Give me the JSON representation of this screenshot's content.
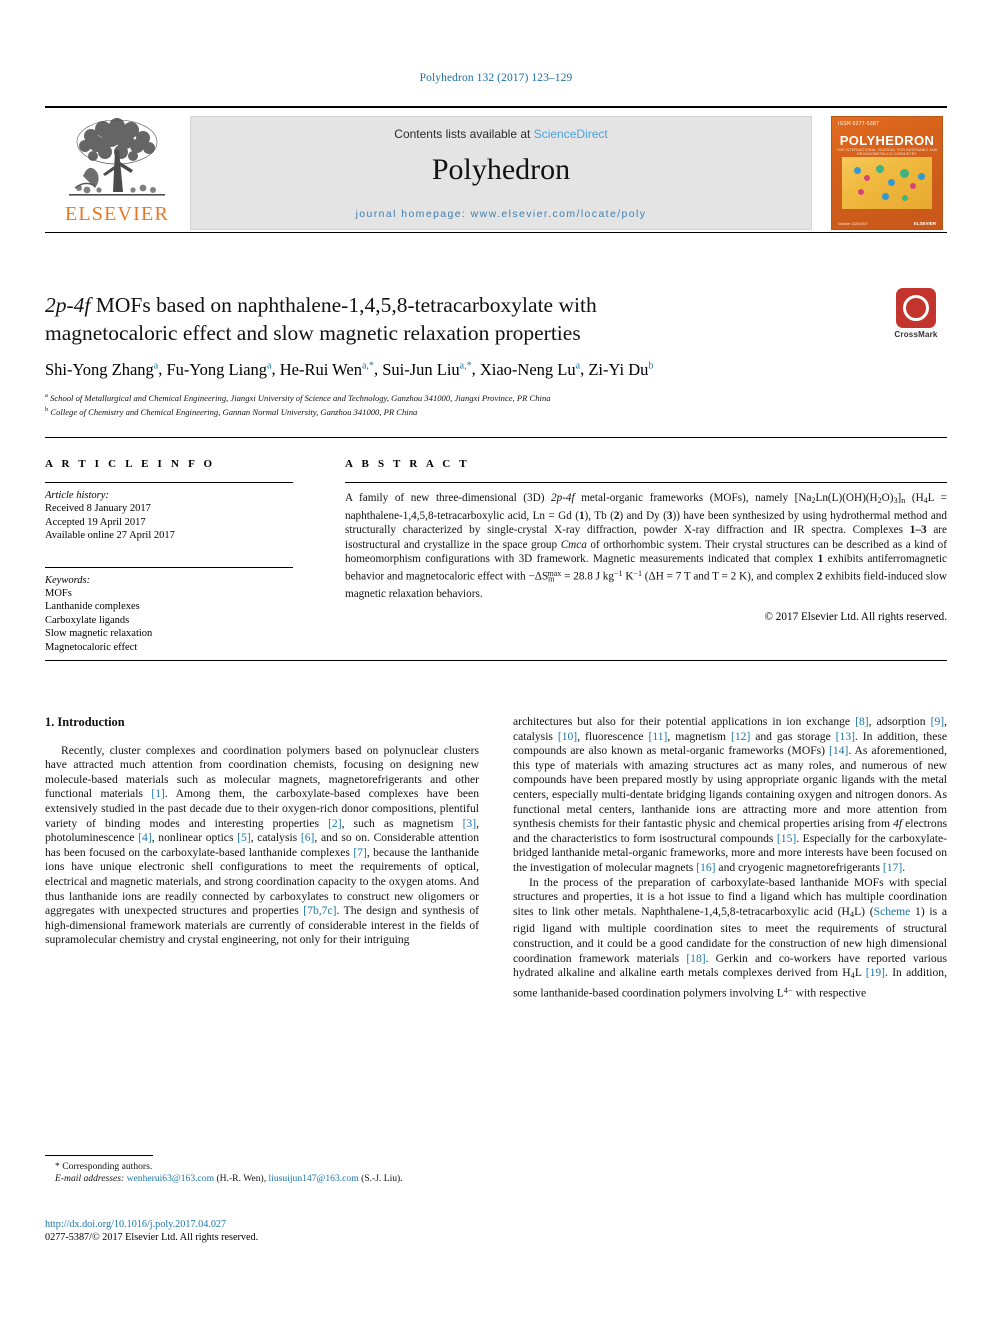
{
  "running_head": "Polyhedron 132 (2017) 123–129",
  "masthead": {
    "publisher_logo_text": "ELSEVIER",
    "contents_prefix": "Contents lists available at ",
    "contents_link": "ScienceDirect",
    "journal_title": "Polyhedron",
    "homepage": "journal homepage: www.elsevier.com/locate/poly",
    "cover": {
      "top_label": "ISSN 0277-5387",
      "name": "POLYHEDRON",
      "subtitle": "THE INTERNATIONAL JOURNAL FOR INORGANIC AND ORGANOMETALLIC CHEMISTRY",
      "foot_left": "Volume 132\\n2017",
      "foot_right": "ELSEVIER"
    }
  },
  "crossmark": {
    "label": "CrossMark"
  },
  "article": {
    "title_line1_pre": "",
    "title_italic": "2p-4f",
    "title_line1_post": " MOFs based on naphthalene-1,4,5,8-tetracarboxylate with",
    "title_line2": "magnetocaloric effect and slow magnetic relaxation properties",
    "authors": [
      {
        "name": "Shi-Yong Zhang",
        "sup": "a",
        "sep": ", "
      },
      {
        "name": "Fu-Yong Liang",
        "sup": "a",
        "sep": ", "
      },
      {
        "name": "He-Rui Wen",
        "sup": "a,*",
        "sep": ", "
      },
      {
        "name": "Sui-Jun Liu",
        "sup": "a,*",
        "sep": ", "
      },
      {
        "name": "Xiao-Neng Lu",
        "sup": "a",
        "sep": ", "
      },
      {
        "name": "Zi-Yi Du",
        "sup": "b",
        "sep": ""
      }
    ],
    "affiliations": [
      {
        "marker": "a",
        "text": "School of Metallurgical and Chemical Engineering, Jiangxi University of Science and Technology, Ganzhou 341000, Jiangxi Province, PR China"
      },
      {
        "marker": "b",
        "text": "College of Chemistry and Chemical Engineering, Gannan Normal University, Ganzhou 341000, PR China"
      }
    ]
  },
  "article_info": {
    "heading": "A R T I C L E  I N F O",
    "history_label": "Article history:",
    "history": [
      "Received 8 January 2017",
      "Accepted 19 April 2017",
      "Available online 27 April 2017"
    ],
    "keywords_label": "Keywords:",
    "keywords": [
      "MOFs",
      "Lanthanide complexes",
      "Carboxylate ligands",
      "Slow magnetic relaxation",
      "Magnetocaloric effect"
    ]
  },
  "abstract": {
    "heading": "A B S T R A C T",
    "text_parts": [
      "A family of new three-dimensional (3D) ",
      "2p-4f",
      " metal-organic frameworks (MOFs), namely [Na",
      "2",
      "Ln(L)(OH)(H",
      "2",
      "O)",
      "3",
      "]",
      "n",
      " (H",
      "4",
      "L = naphthalene-1,4,5,8-tetracarboxylic acid, Ln = Gd (",
      "1",
      "), Tb (",
      "2",
      ") and Dy (",
      "3",
      ")) have been synthesized by using hydrothermal method and structurally characterized by single-crystal X-ray diffraction, powder X-ray diffraction and IR spectra. Complexes ",
      "1–3",
      " are isostructural and crystallize in the space group ",
      "Cmca",
      " of orthorhombic system. Their crystal structures can be described as a kind of homeomorphism configurations with 3D framework. Magnetic measurements indicated that complex ",
      "1",
      " exhibits antiferromagnetic behavior and magnetocaloric effect with ",
      "−ΔS",
      "m",
      "max",
      " = 28.8 J kg",
      "−1",
      " K",
      "−1",
      " (ΔH = 7 T and T = 2 K), and complex ",
      "2",
      " exhibits field-induced slow magnetic relaxation behaviors."
    ],
    "copyright": "© 2017 Elsevier Ltd. All rights reserved."
  },
  "body": {
    "intro_heading": "1. Introduction",
    "left_paragraphs": [
      "Recently, cluster complexes and coordination polymers based on polynuclear clusters have attracted much attention from coordination chemists, focusing on designing new molecule-based materials such as molecular magnets, magnetorefrigerants and other functional materials [1]. Among them, the carboxylate-based complexes have been extensively studied in the past decade due to their oxygen-rich donor compositions, plentiful variety of binding modes and interesting properties [2], such as magnetism [3], photoluminescence [4], nonlinear optics [5], catalysis [6], and so on. Considerable attention has been focused on the carboxylate-based lanthanide complexes [7], because the lanthanide ions have unique electronic shell configurations to meet the requirements of optical, electrical and magnetic materials, and strong coordination capacity to the oxygen atoms. And thus lanthanide ions are readily connected by carboxylates to construct new oligomers or aggregates with unexpected structures and properties [7b,7c]. The design and synthesis of high-dimensional framework materials are currently of considerable interest in the fields of supramolecular chemistry and crystal engineering, not only for their intriguing"
    ],
    "right_paragraphs": [
      "architectures but also for their potential applications in ion exchange [8], adsorption [9], catalysis [10], fluorescence [11], magnetism [12] and gas storage [13]. In addition, these compounds are also known as metal-organic frameworks (MOFs) [14]. As aforementioned, this type of materials with amazing structures act as many roles, and numerous of new compounds have been prepared mostly by using appropriate organic ligands with the metal centers, especially multi-dentate bridging ligands containing oxygen and nitrogen donors. As functional metal centers, lanthanide ions are attracting more and more attention from synthesis chemists for their fantastic physic and chemical properties arising from 4f electrons and the characteristics to form isostructural compounds [15]. Especially for the carboxylate-bridged lanthanide metal-organic frameworks, more and more interests have been focused on the investigation of molecular magnets [16] and cryogenic magnetorefrigerants [17].",
      "In the process of the preparation of carboxylate-based lanthanide MOFs with special structures and properties, it is a hot issue to find a ligand which has multiple coordination sites to link other metals. Naphthalene-1,4,5,8-tetracarboxylic acid (H4L) (Scheme 1) is a rigid ligand with multiple coordination sites to meet the requirements of structural construction, and it could be a good candidate for the construction of new high dimensional coordination framework materials [18]. Gerkin and co-workers have reported various hydrated alkaline and alkaline earth metals complexes derived from H4L [19]. In addition, some lanthanide-based coordination polymers involving L4− with respective"
    ]
  },
  "footnotes": {
    "corresponding": "* Corresponding authors.",
    "email_label": "E-mail addresses:",
    "email1": "wenherui63@163.com",
    "email1_owner": "(H.-R. Wen),",
    "email2": "liusuijun147@163.com",
    "email2_owner": "(S.-J. Liu)."
  },
  "doi_block": {
    "doi": "http://dx.doi.org/10.1016/j.poly.2017.04.027",
    "issn_line": "0277-5387/© 2017 Elsevier Ltd. All rights reserved."
  },
  "colors": {
    "link_blue": "#1a76a8",
    "sciencedirect_blue": "#4aa3df",
    "elsevier_orange": "#E87722",
    "crossmark_red": "#c2342c",
    "banner_gray": "#e4e4e4"
  }
}
